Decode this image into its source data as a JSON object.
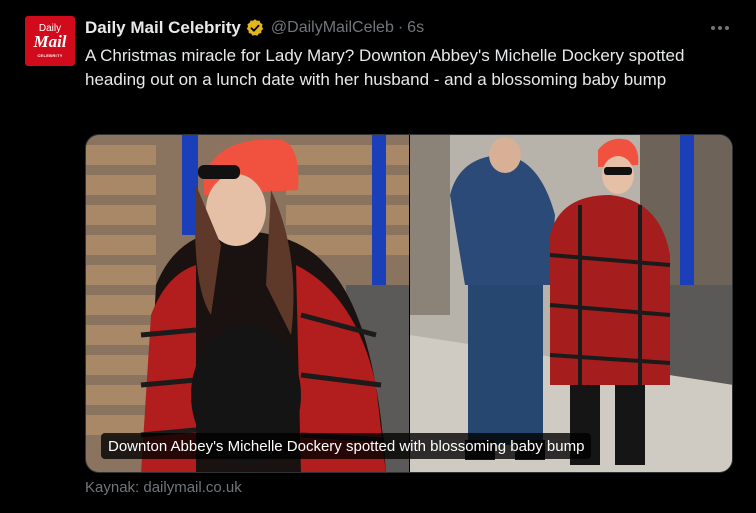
{
  "avatar": {
    "line1": "Daily",
    "line2": "Mail",
    "line3": "CELEBRITY"
  },
  "author": {
    "name": "Daily Mail Celebrity",
    "handle": "@DailyMailCeleb",
    "separator": "·",
    "time": "6s",
    "verified_color": "#e2b719"
  },
  "tweet": {
    "text": "A Christmas miracle for Lady Mary? Downton Abbey's Michelle Dockery spotted heading out on a lunch date with her husband - and a blossoming baby bump"
  },
  "media": {
    "caption": "Downton Abbey's Michelle Dockery spotted with blossoming baby bump"
  },
  "source": {
    "text": "Kaynak: dailymail.co.uk"
  },
  "colors": {
    "background": "#000000",
    "brand_red": "#d10a1c",
    "muted_text": "#71767b"
  },
  "icons": {
    "verified": "verified-badge-icon",
    "more": "more-horizontal-icon"
  }
}
